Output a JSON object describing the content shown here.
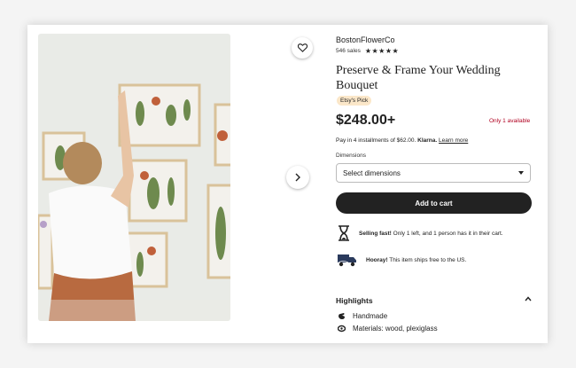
{
  "listing": {
    "shop_name": "BostonFlowerCo",
    "sales": "546 sales",
    "stars": "★★★★★",
    "title": "Preserve & Frame Your Wedding Bouquet",
    "badge": "Etsy's Pick",
    "price": "$248.00+",
    "availability": "Only 1 available",
    "klarna_prefix": "Pay in 4 installments of $62.00.",
    "klarna_brand": "Klarna.",
    "klarna_link": "Learn more",
    "dimensions_label": "Dimensions",
    "dimensions_value": "Select dimensions",
    "cart_label": "Add to cart",
    "selling_bold": "Selling fast!",
    "selling_text": "Only 1 left, and 1 person has it in their cart.",
    "ship_bold": "Hooray!",
    "ship_text": "This item ships free to the US.",
    "highlights_title": "Highlights",
    "highlights": [
      "Handmade",
      "Materials: wood, plexiglass"
    ]
  },
  "icons": {
    "favorite": "heart-icon",
    "next": "chevron-right-icon",
    "select": "caret-down-icon",
    "hourglass": "hourglass-icon",
    "truck": "truck-icon",
    "collapse": "chevron-up-icon"
  },
  "colors": {
    "availability": "#b00020",
    "badge_bg": "#fbe7c9",
    "button_bg": "#222222"
  }
}
